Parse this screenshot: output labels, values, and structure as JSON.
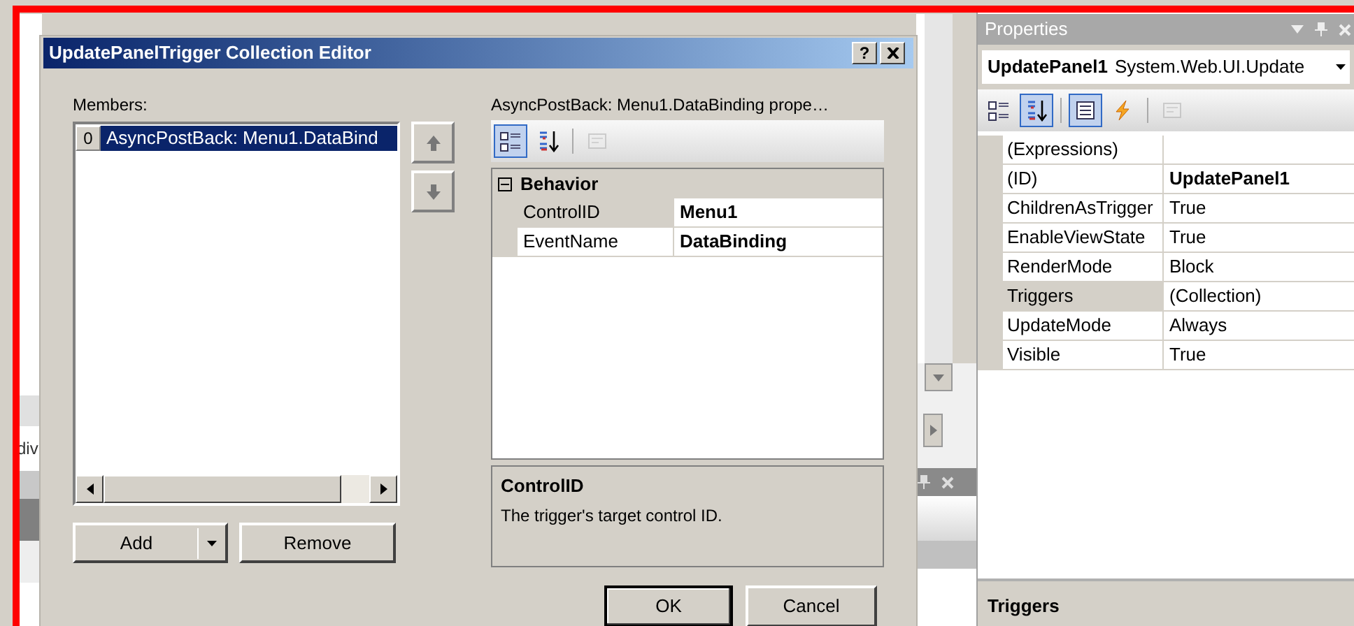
{
  "background": {
    "tag_text": "div"
  },
  "dialog": {
    "title": "UpdatePanelTrigger Collection Editor",
    "help_button": "?",
    "members_label": "Members:",
    "members": [
      {
        "index": "0",
        "text": "AsyncPostBack: Menu1.DataBind",
        "selected": true
      }
    ],
    "add_button": "Add",
    "remove_button": "Remove",
    "properties_label": "AsyncPostBack: Menu1.DataBinding prope…",
    "toolbar": [
      {
        "kind": "categorized",
        "selected": true,
        "disabled": false
      },
      {
        "kind": "alphabetical",
        "selected": false,
        "disabled": false
      },
      {
        "kind": "pages",
        "selected": false,
        "disabled": true
      }
    ],
    "category": {
      "name": "Behavior",
      "expanded": true
    },
    "rows": [
      {
        "name": "ControlID",
        "value": "Menu1",
        "selected": true
      },
      {
        "name": "EventName",
        "value": "DataBinding",
        "selected": false
      }
    ],
    "description": {
      "title": "ControlID",
      "text": "The trigger's target control ID."
    },
    "ok_button": "OK",
    "cancel_button": "Cancel"
  },
  "properties_panel": {
    "title": "Properties",
    "object_name": "UpdatePanel1",
    "object_type": "System.Web.UI.Update",
    "toolbar": [
      {
        "kind": "categorized",
        "selected": false,
        "disabled": false
      },
      {
        "kind": "alphabetical",
        "selected": true,
        "disabled": false
      },
      {
        "kind": "properties",
        "selected": true,
        "disabled": false
      },
      {
        "kind": "events",
        "selected": false,
        "disabled": false
      },
      {
        "kind": "pages",
        "selected": false,
        "disabled": true
      }
    ],
    "rows": [
      {
        "name": "(Expressions)",
        "selected": false
      },
      {
        "name": "(ID)",
        "value": "UpdatePanel1",
        "bold": true,
        "selected": false
      },
      {
        "name": "ChildrenAsTrigger",
        "value": "True",
        "bold": false,
        "selected": false
      },
      {
        "name": "EnableViewState",
        "value": "True",
        "bold": false,
        "selected": false
      },
      {
        "name": "RenderMode",
        "value": "Block",
        "bold": false,
        "selected": false
      },
      {
        "name": "Triggers",
        "value": "(Collection)",
        "bold": false,
        "selected": true
      },
      {
        "name": "UpdateMode",
        "value": "Always",
        "bold": false,
        "selected": false
      },
      {
        "name": "Visible",
        "value": "True",
        "bold": false,
        "selected": false
      }
    ],
    "description_title": "Triggers"
  }
}
